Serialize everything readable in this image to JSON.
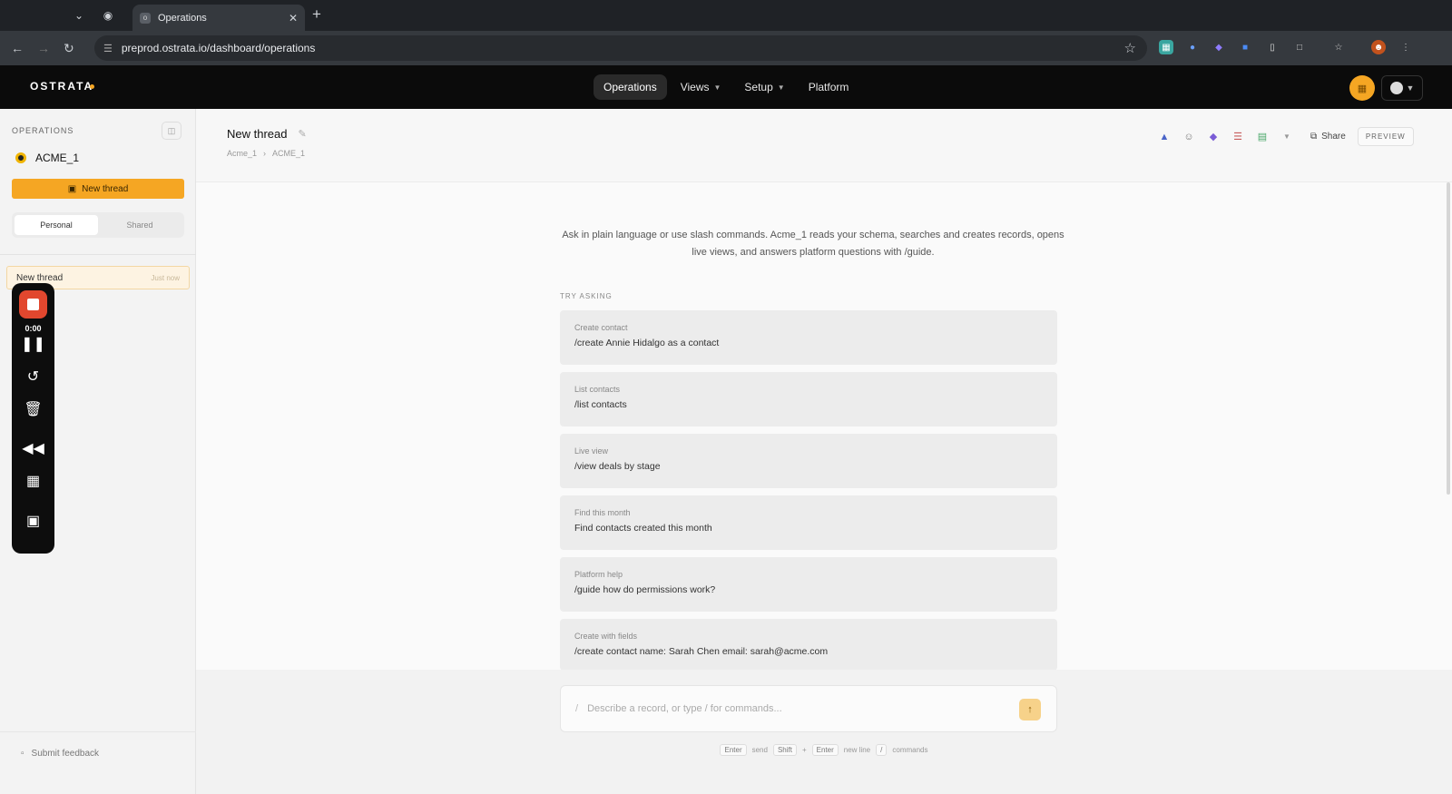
{
  "browser": {
    "tab_title": "Operations",
    "url": "preprod.ostrata.io/dashboard/operations"
  },
  "header": {
    "logo": "OSTRATA",
    "nav": [
      {
        "label": "Operations",
        "active": true
      },
      {
        "label": "Views",
        "dropdown": true
      },
      {
        "label": "Setup",
        "dropdown": true
      },
      {
        "label": "Platform"
      }
    ]
  },
  "sidebar": {
    "title": "OPERATIONS",
    "workspace": "ACME_1",
    "new_thread_label": "New thread",
    "tabs": [
      "Personal",
      "Shared"
    ],
    "active_tab": "Personal",
    "threads": [
      {
        "title": "New thread",
        "time": "Just now"
      }
    ],
    "feedback_label": "Submit feedback"
  },
  "recorder": {
    "time": "0:00"
  },
  "main": {
    "thread_title": "New thread",
    "breadcrumbs": [
      "Acme_1",
      "ACME_1"
    ],
    "share_label": "Share",
    "preview_label": "PREVIEW",
    "intro": "Ask in plain language or use slash commands. Acme_1 reads your schema, searches and creates records, opens live views, and answers platform questions with /guide.",
    "try_label": "TRY ASKING",
    "suggestions": [
      {
        "label": "Create contact",
        "command": "/create Annie Hidalgo as a contact"
      },
      {
        "label": "List contacts",
        "command": "/list contacts"
      },
      {
        "label": "Live view",
        "command": "/view deals by stage"
      },
      {
        "label": "Find this month",
        "command": "Find contacts created this month"
      },
      {
        "label": "Platform help",
        "command": "/guide how do permissions work?"
      },
      {
        "label": "Create with fields",
        "command": "/create contact name: Sarah Chen email: sarah@acme.com"
      }
    ],
    "composer": {
      "placeholder": "Describe a record, or type / for commands..."
    },
    "hints": {
      "enter": "Enter",
      "send": "send",
      "shift": "Shift",
      "plus": "+",
      "enter2": "Enter",
      "newline": "new line",
      "slash": "/",
      "commands": "commands"
    }
  },
  "colors": {
    "accent": "#f5a623",
    "header_bg": "#0b0b0b",
    "recorder_stop": "#e2472e"
  }
}
